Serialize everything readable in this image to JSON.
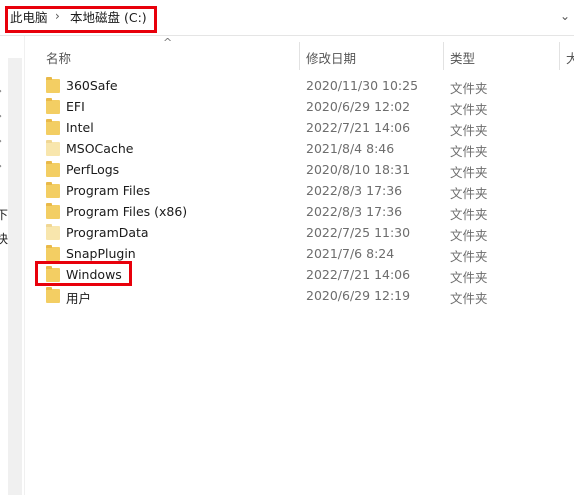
{
  "address": {
    "crumbs": [
      "此电脑",
      "本地磁盘 (C:)"
    ],
    "separator": "›",
    "history_chevron": "⌄"
  },
  "nav": {
    "fragments": [
      "下",
      "快"
    ]
  },
  "columns": {
    "name": "名称",
    "modified": "修改日期",
    "type": "类型",
    "size": "大"
  },
  "files": [
    {
      "name": "360Safe",
      "modified": "2020/11/30 10:25",
      "type": "文件夹",
      "icon": "folder-icon"
    },
    {
      "name": "EFI",
      "modified": "2020/6/29 12:02",
      "type": "文件夹",
      "icon": "folder-icon"
    },
    {
      "name": "Intel",
      "modified": "2022/7/21 14:06",
      "type": "文件夹",
      "icon": "folder-icon"
    },
    {
      "name": "MSOCache",
      "modified": "2021/8/4 8:46",
      "type": "文件夹",
      "icon": "folder-hidden-icon"
    },
    {
      "name": "PerfLogs",
      "modified": "2020/8/10 18:31",
      "type": "文件夹",
      "icon": "folder-icon"
    },
    {
      "name": "Program Files",
      "modified": "2022/8/3 17:36",
      "type": "文件夹",
      "icon": "folder-icon"
    },
    {
      "name": "Program Files (x86)",
      "modified": "2022/8/3 17:36",
      "type": "文件夹",
      "icon": "folder-icon"
    },
    {
      "name": "ProgramData",
      "modified": "2022/7/25 11:30",
      "type": "文件夹",
      "icon": "folder-hidden-icon"
    },
    {
      "name": "SnapPlugin",
      "modified": "2021/7/6 8:24",
      "type": "文件夹",
      "icon": "folder-icon"
    },
    {
      "name": "Windows",
      "modified": "2022/7/21 14:06",
      "type": "文件夹",
      "icon": "folder-icon"
    },
    {
      "name": "用户",
      "modified": "2020/6/29 12:19",
      "type": "文件夹",
      "icon": "folder-icon"
    }
  ],
  "highlight_color": "#e8000b"
}
